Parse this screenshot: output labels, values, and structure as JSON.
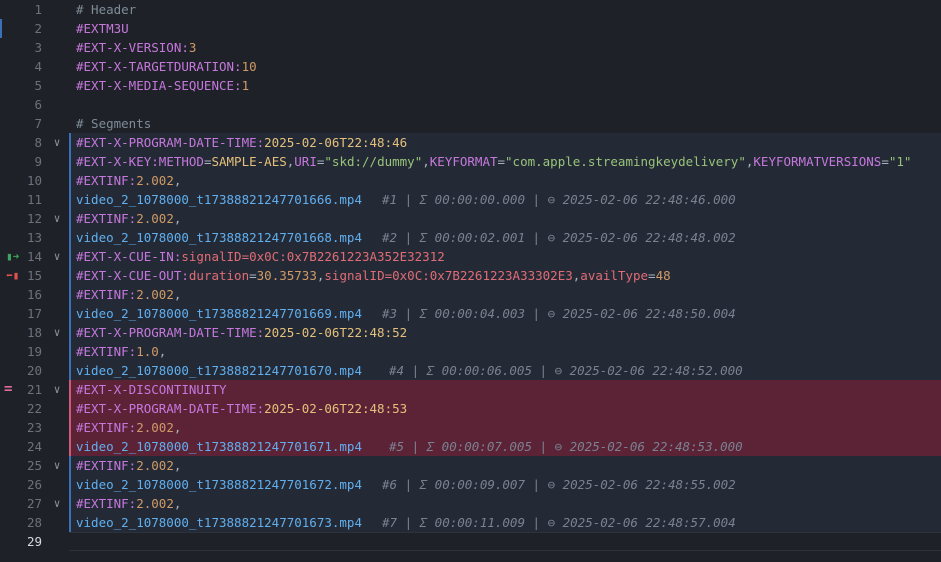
{
  "editor": {
    "lines": [
      {
        "n": "1",
        "parts": [
          {
            "t": "# Header",
            "c": "cm"
          }
        ]
      },
      {
        "n": "2",
        "parts": [
          {
            "t": "#EXTM3U",
            "c": "tag"
          }
        ]
      },
      {
        "n": "3",
        "parts": [
          {
            "t": "#EXT-X-VERSION:",
            "c": "tag"
          },
          {
            "t": "3",
            "c": "num"
          }
        ]
      },
      {
        "n": "4",
        "parts": [
          {
            "t": "#EXT-X-TARGETDURATION:",
            "c": "tag"
          },
          {
            "t": "10",
            "c": "num"
          }
        ]
      },
      {
        "n": "5",
        "parts": [
          {
            "t": "#EXT-X-MEDIA-SEQUENCE:",
            "c": "tag"
          },
          {
            "t": "1",
            "c": "num"
          }
        ]
      },
      {
        "n": "6",
        "parts": []
      },
      {
        "n": "7",
        "parts": [
          {
            "t": "# Segments",
            "c": "cm"
          }
        ]
      },
      {
        "n": "8",
        "fold": "∨",
        "block": true,
        "parts": [
          {
            "t": "#EXT-X-PROGRAM-DATE-TIME:",
            "c": "tag"
          },
          {
            "t": "2025-02-06T22:48:46",
            "c": "val"
          }
        ]
      },
      {
        "n": "9",
        "block": true,
        "parts": [
          {
            "t": "#EXT-X-KEY:",
            "c": "tag"
          },
          {
            "t": "METHOD",
            "c": "attr"
          },
          {
            "t": "=",
            "c": "p"
          },
          {
            "t": "SAMPLE-AES",
            "c": "val"
          },
          {
            "t": ",",
            "c": "p"
          },
          {
            "t": "URI",
            "c": "attr"
          },
          {
            "t": "=",
            "c": "p"
          },
          {
            "t": "\"skd://dummy\"",
            "c": "str"
          },
          {
            "t": ",",
            "c": "p"
          },
          {
            "t": "KEYFORMAT",
            "c": "attr"
          },
          {
            "t": "=",
            "c": "p"
          },
          {
            "t": "\"com.apple.streamingkeydelivery\"",
            "c": "str"
          },
          {
            "t": ",",
            "c": "p"
          },
          {
            "t": "KEYFORMATVERSIONS",
            "c": "attr"
          },
          {
            "t": "=",
            "c": "p"
          },
          {
            "t": "\"1\"",
            "c": "str"
          }
        ]
      },
      {
        "n": "10",
        "block": true,
        "parts": [
          {
            "t": "#EXTINF:",
            "c": "tag"
          },
          {
            "t": "2.002",
            "c": "num"
          },
          {
            "t": ",",
            "c": "p"
          }
        ]
      },
      {
        "n": "11",
        "block": true,
        "parts": [
          {
            "t": "video_2_1078000_t17388821247701666.mp4",
            "c": "uri"
          }
        ],
        "hint": "#1 | Σ 00:00:00.000 | ⊖ 2025-02-06 22:48:46.000"
      },
      {
        "n": "12",
        "fold": "∨",
        "block": true,
        "parts": [
          {
            "t": "#EXTINF:",
            "c": "tag"
          },
          {
            "t": "2.002",
            "c": "num"
          },
          {
            "t": ",",
            "c": "p"
          }
        ]
      },
      {
        "n": "13",
        "block": true,
        "parts": [
          {
            "t": "video_2_1078000_t17388821247701668.mp4",
            "c": "uri"
          }
        ],
        "hint": "#2 | Σ 00:00:02.001 | ⊖ 2025-02-06 22:48:48.002"
      },
      {
        "n": "14",
        "fold": "∨",
        "block": true,
        "mark": "in",
        "parts": [
          {
            "t": "#EXT-X-CUE-IN:",
            "c": "tag"
          },
          {
            "t": "signalID=0x0C:0x7B2261223A352E32312",
            "c": "cueout"
          }
        ]
      },
      {
        "n": "15",
        "block": true,
        "mark": "out",
        "parts": [
          {
            "t": "#EXT-X-CUE-OUT:",
            "c": "tag"
          },
          {
            "t": "duration",
            "c": "cueout"
          },
          {
            "t": "=",
            "c": "p"
          },
          {
            "t": "30.35733",
            "c": "num"
          },
          {
            "t": ",",
            "c": "p"
          },
          {
            "t": "signalID",
            "c": "cueout"
          },
          {
            "t": "=0x0C:0x7B2261223A33302E3",
            "c": "cueout"
          },
          {
            "t": ",",
            "c": "p"
          },
          {
            "t": "availType",
            "c": "cueout"
          },
          {
            "t": "=",
            "c": "p"
          },
          {
            "t": "48",
            "c": "num"
          }
        ]
      },
      {
        "n": "16",
        "block": true,
        "parts": [
          {
            "t": "#EXTINF:",
            "c": "tag"
          },
          {
            "t": "2.002",
            "c": "num"
          },
          {
            "t": ",",
            "c": "p"
          }
        ]
      },
      {
        "n": "17",
        "block": true,
        "parts": [
          {
            "t": "video_2_1078000_t17388821247701669.mp4",
            "c": "uri"
          }
        ],
        "hint": "#3 | Σ 00:00:04.003 | ⊖ 2025-02-06 22:48:50.004"
      },
      {
        "n": "18",
        "fold": "∨",
        "block": true,
        "parts": [
          {
            "t": "#EXT-X-PROGRAM-DATE-TIME:",
            "c": "tag"
          },
          {
            "t": "2025-02-06T22:48:52",
            "c": "val"
          }
        ]
      },
      {
        "n": "19",
        "block": true,
        "parts": [
          {
            "t": "#EXTINF:",
            "c": "tag"
          },
          {
            "t": "1.0",
            "c": "num"
          },
          {
            "t": ",",
            "c": "p"
          }
        ]
      },
      {
        "n": "20",
        "block": true,
        "parts": [
          {
            "t": "video_2_1078000_t17388821247701670.mp4",
            "c": "uri"
          }
        ],
        "hint": "#4 | Σ 00:00:06.005 | ⊖ 2025-02-06 22:48:52.000",
        "hintShift": true
      },
      {
        "n": "21",
        "fold": "∨",
        "disc": true,
        "mark": "eq",
        "parts": [
          {
            "t": "#EXT-X-DISCONTINUITY",
            "c": "tag"
          }
        ]
      },
      {
        "n": "22",
        "disc": true,
        "parts": [
          {
            "t": "#EXT-X-PROGRAM-DATE-TIME:",
            "c": "tag"
          },
          {
            "t": "2025-02-06T22:48:53",
            "c": "val"
          }
        ]
      },
      {
        "n": "23",
        "disc": true,
        "parts": [
          {
            "t": "#EXTINF:",
            "c": "tag"
          },
          {
            "t": "2.002",
            "c": "num"
          },
          {
            "t": ",",
            "c": "p"
          }
        ]
      },
      {
        "n": "24",
        "disc": true,
        "parts": [
          {
            "t": "video_2_1078000_t17388821247701671.mp4",
            "c": "uri"
          }
        ],
        "hint": "#5 | Σ 00:00:07.005 | ⊖ 2025-02-06 22:48:53.000",
        "hintShift": true
      },
      {
        "n": "25",
        "fold": "∨",
        "block": true,
        "parts": [
          {
            "t": "#EXTINF:",
            "c": "tag"
          },
          {
            "t": "2.002",
            "c": "num"
          },
          {
            "t": ",",
            "c": "p"
          }
        ]
      },
      {
        "n": "26",
        "block": true,
        "parts": [
          {
            "t": "video_2_1078000_t17388821247701672.mp4",
            "c": "uri"
          }
        ],
        "hint": "#6 | Σ 00:00:09.007 | ⊖ 2025-02-06 22:48:55.002"
      },
      {
        "n": "27",
        "fold": "∨",
        "block": true,
        "parts": [
          {
            "t": "#EXTINF:",
            "c": "tag"
          },
          {
            "t": "2.002",
            "c": "num"
          },
          {
            "t": ",",
            "c": "p"
          }
        ]
      },
      {
        "n": "28",
        "block": true,
        "parts": [
          {
            "t": "video_2_1078000_t17388821247701673.mp4",
            "c": "uri"
          }
        ],
        "hint": "#7 | Σ 00:00:11.009 | ⊖ 2025-02-06 22:48:57.004"
      },
      {
        "n": "29",
        "active": true,
        "parts": []
      }
    ]
  },
  "colors": {
    "background": "#1e2127",
    "discontinuity": "#5c2337",
    "segment_block": "#232a36",
    "tag": "#c678dd",
    "uri": "#61afef",
    "string": "#98c379",
    "number": "#d19a66"
  }
}
